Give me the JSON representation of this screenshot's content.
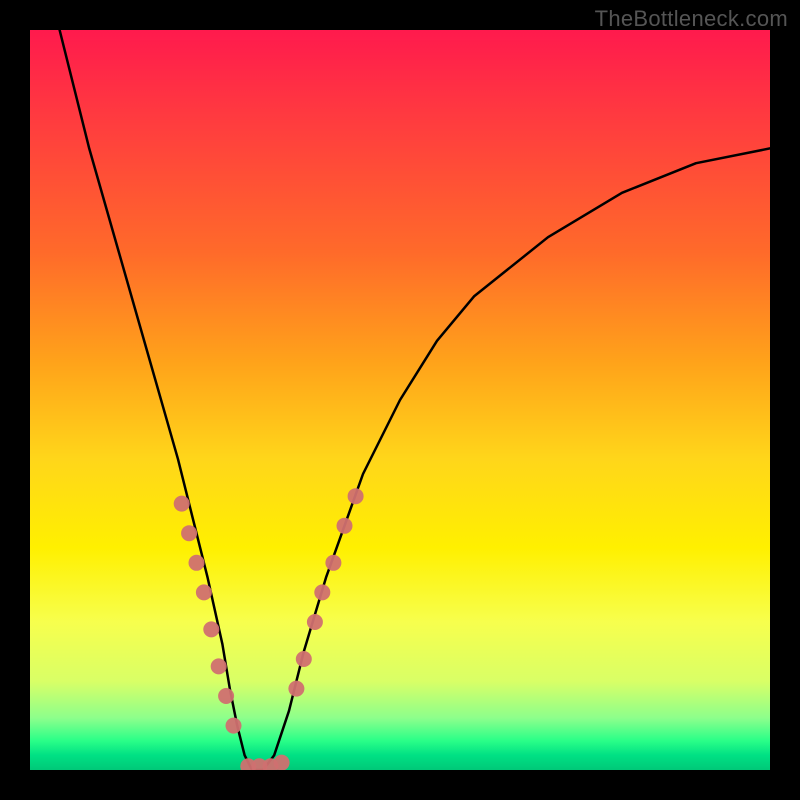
{
  "watermark": "TheBottleneck.com",
  "chart_data": {
    "type": "line",
    "title": "",
    "xlabel": "",
    "ylabel": "",
    "xlim": [
      0,
      100
    ],
    "ylim": [
      0,
      100
    ],
    "grid": false,
    "legend": false,
    "background_gradient": {
      "orientation": "vertical",
      "stops": [
        {
          "pos": 0.0,
          "color": "#ff1a4d"
        },
        {
          "pos": 0.12,
          "color": "#ff3b3f"
        },
        {
          "pos": 0.3,
          "color": "#ff6a2a"
        },
        {
          "pos": 0.45,
          "color": "#ffa31a"
        },
        {
          "pos": 0.58,
          "color": "#ffd61a"
        },
        {
          "pos": 0.7,
          "color": "#fff000"
        },
        {
          "pos": 0.8,
          "color": "#f7ff4d"
        },
        {
          "pos": 0.88,
          "color": "#d9ff66"
        },
        {
          "pos": 0.93,
          "color": "#8cff8c"
        },
        {
          "pos": 0.96,
          "color": "#2bff88"
        },
        {
          "pos": 0.98,
          "color": "#00e184"
        },
        {
          "pos": 1.0,
          "color": "#00c878"
        }
      ]
    },
    "series": [
      {
        "name": "bottleneck-curve",
        "color": "#000000",
        "stroke_width": 2.5,
        "x": [
          4,
          8,
          12,
          16,
          20,
          22,
          24,
          26,
          27,
          28,
          29,
          30,
          31.5,
          33,
          35,
          37,
          40,
          45,
          50,
          55,
          60,
          70,
          80,
          90,
          100
        ],
        "values": [
          100,
          84,
          70,
          56,
          42,
          34,
          26,
          17,
          11,
          6,
          2,
          0,
          0,
          2,
          8,
          16,
          26,
          40,
          50,
          58,
          64,
          72,
          78,
          82,
          84
        ]
      }
    ],
    "marker_clusters": [
      {
        "name": "left-cluster",
        "color": "#d07070",
        "radius": 8,
        "points": [
          {
            "x": 20.5,
            "y": 36
          },
          {
            "x": 21.5,
            "y": 32
          },
          {
            "x": 22.5,
            "y": 28
          },
          {
            "x": 23.5,
            "y": 24
          },
          {
            "x": 24.5,
            "y": 19
          },
          {
            "x": 25.5,
            "y": 14
          },
          {
            "x": 26.5,
            "y": 10
          },
          {
            "x": 27.5,
            "y": 6
          }
        ]
      },
      {
        "name": "bottom-cluster",
        "color": "#d07070",
        "radius": 8,
        "points": [
          {
            "x": 29.5,
            "y": 0.5
          },
          {
            "x": 31.0,
            "y": 0.5
          },
          {
            "x": 32.5,
            "y": 0.5
          },
          {
            "x": 34.0,
            "y": 1.0
          }
        ]
      },
      {
        "name": "right-cluster",
        "color": "#d07070",
        "radius": 8,
        "points": [
          {
            "x": 36.0,
            "y": 11
          },
          {
            "x": 37.0,
            "y": 15
          },
          {
            "x": 38.5,
            "y": 20
          },
          {
            "x": 39.5,
            "y": 24
          },
          {
            "x": 41.0,
            "y": 28
          },
          {
            "x": 42.5,
            "y": 33
          },
          {
            "x": 44.0,
            "y": 37
          }
        ]
      }
    ]
  }
}
